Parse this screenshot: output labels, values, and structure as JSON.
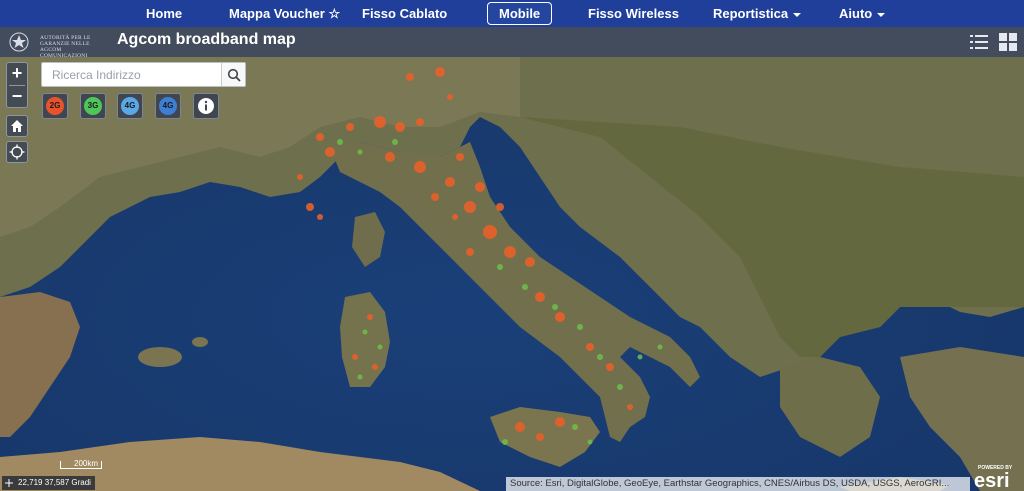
{
  "nav": {
    "items": [
      {
        "label": "Home"
      },
      {
        "label": "Mappa Voucher ☆"
      },
      {
        "label": "Fisso Cablato"
      },
      {
        "label": "Mobile"
      },
      {
        "label": "Fisso Wireless"
      },
      {
        "label": "Reportistica"
      },
      {
        "label": "Aiuto"
      }
    ],
    "active": "Mobile"
  },
  "header": {
    "logo_lines": [
      "AUTORITÀ PER LE",
      "GARANZIE NELLE",
      "AGCOM COMUNICAZIONI"
    ],
    "title": "Agcom broadband map",
    "buttons": [
      "list-icon",
      "grid-icon"
    ]
  },
  "map": {
    "zoom_in": "+",
    "zoom_out": "−",
    "home_icon": "home-icon",
    "locate_icon": "crosshair-icon",
    "search": {
      "placeholder": "Ricerca Indirizzo"
    },
    "layers": [
      {
        "label": "2G",
        "color": "#e8532a"
      },
      {
        "label": "3G",
        "color": "#4fc65a"
      },
      {
        "label": "4G",
        "color": "#5aa8e8"
      },
      {
        "label": "4G",
        "color": "#3d7fd4"
      }
    ],
    "info_icon": "info-icon",
    "scale_label": "200km",
    "coordinates": "22,719 37,587 Gradi",
    "attribution": "Source: Esri, DigitalGlobe, GeoEye, Earthstar Geographics, CNES/Airbus DS, USDA, USGS, AeroGRI...",
    "powered_by": "POWERED BY",
    "brand": "esri",
    "colors": {
      "sea": "#1e4377",
      "land": "#6b6e4c",
      "coverage_2g": "#e8602a",
      "coverage_3g": "#6cc04a"
    }
  }
}
